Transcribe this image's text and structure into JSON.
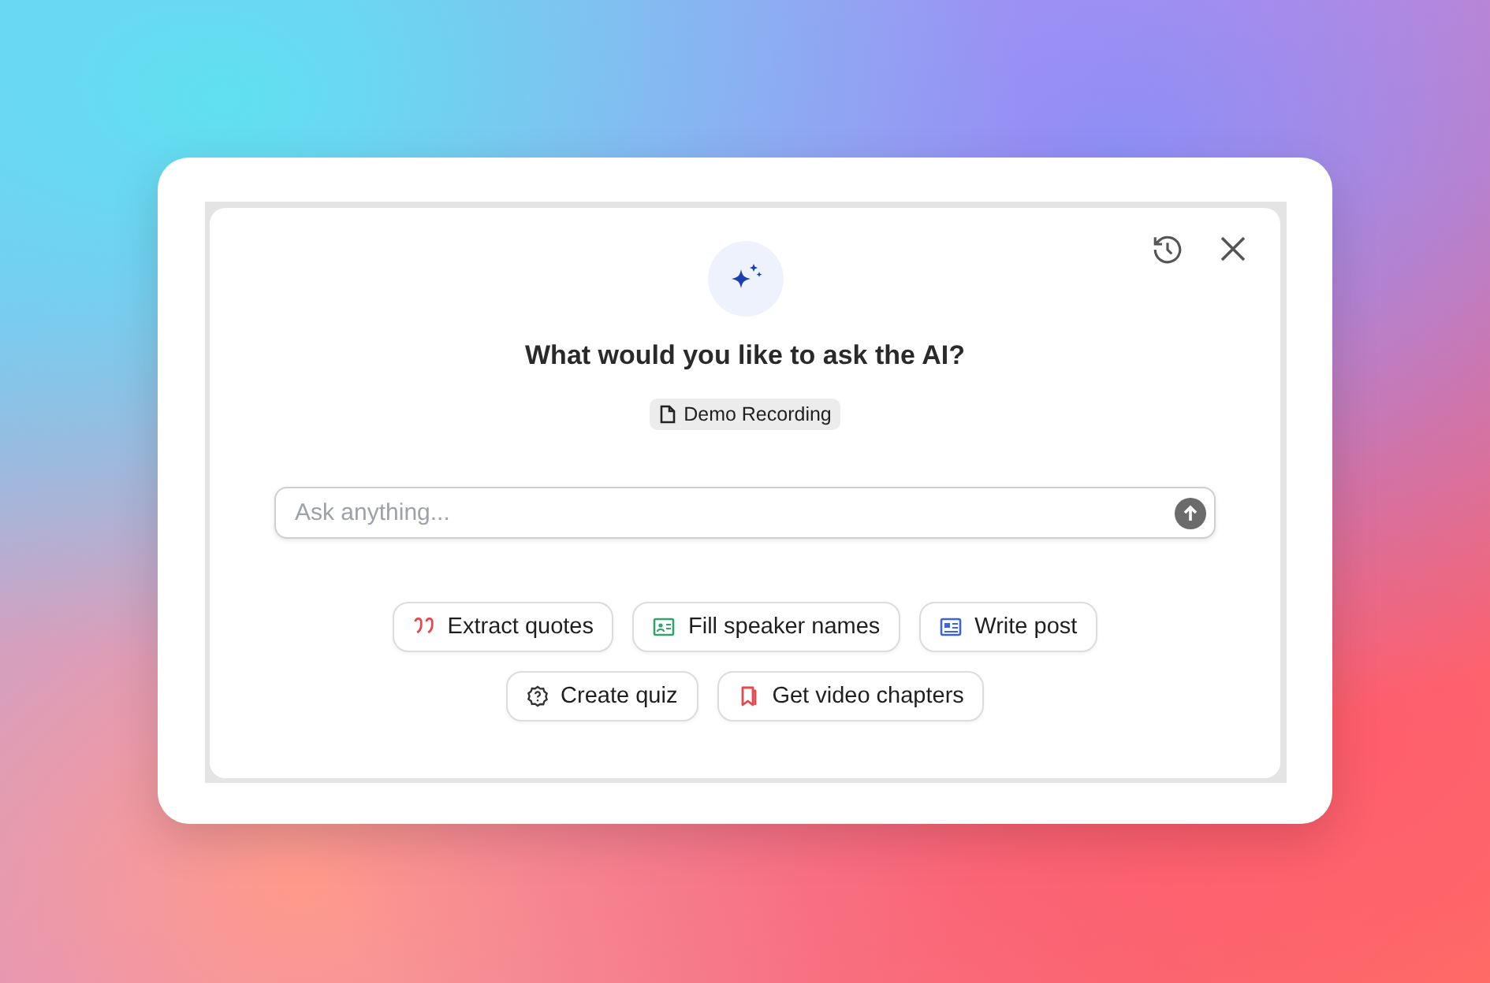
{
  "dialog": {
    "title": "What would you like to ask the AI?",
    "source_tag": "Demo Recording",
    "input": {
      "placeholder": "Ask anything..."
    },
    "suggestions": [
      [
        {
          "label": "Extract quotes",
          "kind": "quote",
          "color": "#e5484d"
        },
        {
          "label": "Fill speaker names",
          "kind": "idcard",
          "color": "#30a46c"
        },
        {
          "label": "Write post",
          "kind": "article",
          "color": "#3e63dd"
        }
      ],
      [
        {
          "label": "Create quiz",
          "kind": "quiz",
          "color": "#333333"
        },
        {
          "label": "Get video chapters",
          "kind": "bookmark",
          "color": "#e5484d"
        }
      ]
    ]
  }
}
